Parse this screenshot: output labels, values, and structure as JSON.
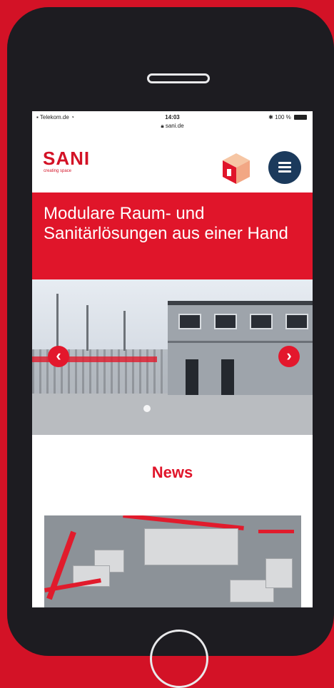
{
  "status_bar": {
    "carrier": "Telekom.de",
    "time": "14:03",
    "url": "sani.de",
    "battery": "100 %"
  },
  "header": {
    "logo_text": "SANI",
    "logo_tagline": "creating space",
    "cube_icon": "cube-icon",
    "menu_icon": "hamburger-icon"
  },
  "hero": {
    "title": "Modulare Raum- und Sanitärlösungen aus einer Hand"
  },
  "slider": {
    "prev_label": "‹",
    "next_label": "›",
    "prev_icon": "chevron-left-icon",
    "next_icon": "chevron-right-icon"
  },
  "news": {
    "heading": "News"
  },
  "colors": {
    "brand_red": "#e0152a",
    "navy": "#1b3a5c",
    "phone_body": "#1d1c21"
  }
}
